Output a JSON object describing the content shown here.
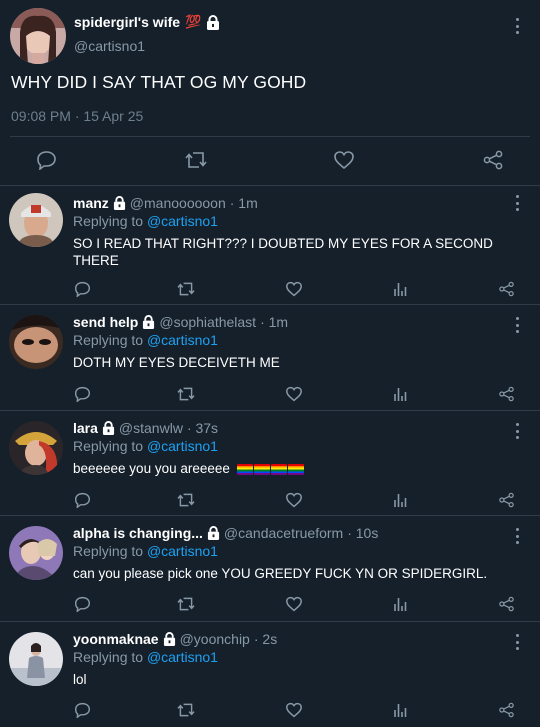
{
  "main_tweet": {
    "display_name": "spidergirl's wife",
    "emoji": "💯",
    "handle": "@cartisno1",
    "text": "WHY DID I SAY THAT OG MY GOHD",
    "timestamp": "09:08 PM · 15 Apr 25",
    "icons": [
      "comment-icon",
      "retweet-icon",
      "like-icon",
      "share-icon"
    ]
  },
  "replies": [
    {
      "name": "manz",
      "handle": "@manoooooon",
      "time": "· 1m",
      "replying_prefix": "Replying to",
      "replying_to": "@cartisno1",
      "text": "SO I READ THAT RIGHT??? I DOUBTED MY EYES FOR A SECOND THERE"
    },
    {
      "name": "send help",
      "handle": "@sophiathelast",
      "time": "· 1m",
      "replying_prefix": "Replying to",
      "replying_to": "@cartisno1",
      "text": "DOTH MY EYES DECEIVETH ME"
    },
    {
      "name": "lara",
      "handle": "@stanwlw",
      "time": "· 37s",
      "replying_prefix": "Replying to",
      "replying_to": "@cartisno1",
      "text": "beeeeee you you areeeee",
      "emoji": "🏳️‍🌈🏳️‍🌈🏳️‍🌈🏳️‍🌈"
    },
    {
      "name": "alpha is changing...",
      "handle": "@candacetrueform",
      "time": "· 10s",
      "replying_prefix": "Replying to",
      "replying_to": "@cartisno1",
      "text": "can you please pick one YOU GREEDY FUCK YN OR SPIDERGIRL."
    },
    {
      "name": "yoonmaknae",
      "handle": "@yoonchip",
      "time": "· 2s",
      "replying_prefix": "Replying to",
      "replying_to": "@cartisno1",
      "text": "lol"
    }
  ],
  "colors": {
    "background": "#15202b",
    "text": "#ffffff",
    "secondary": "#8899a6",
    "link": "#1da1f2",
    "divider": "#2f3b47"
  }
}
